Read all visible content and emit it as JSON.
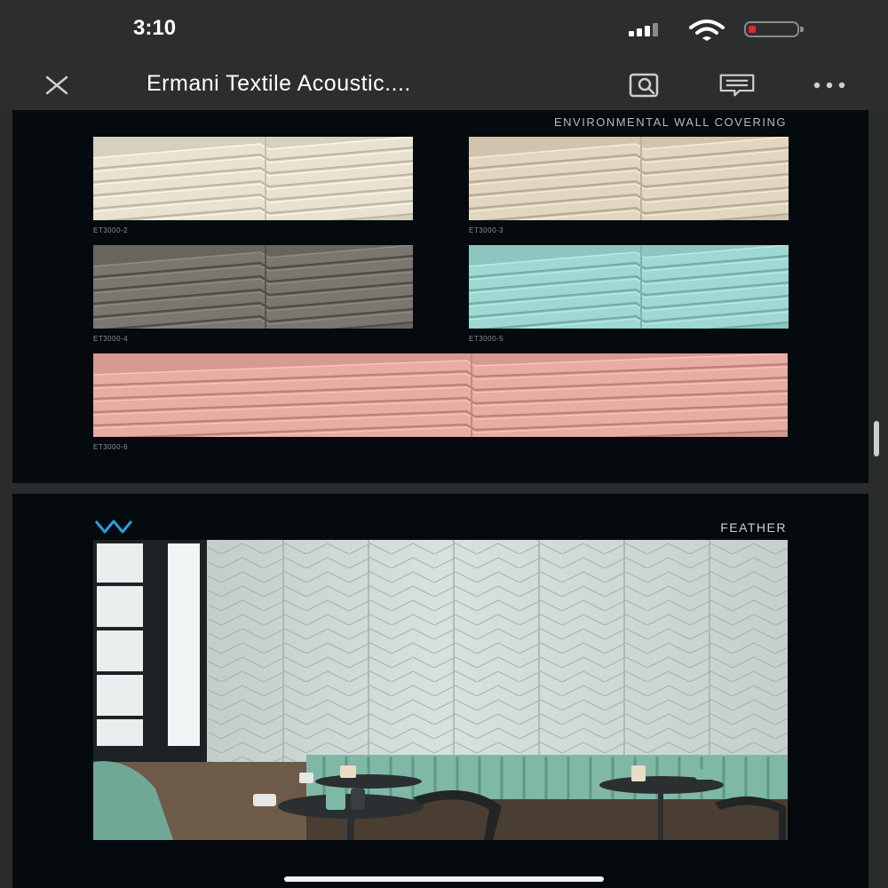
{
  "status_bar": {
    "time": "3:10"
  },
  "nav": {
    "title": "Ermani Textile Acoustic...."
  },
  "page1": {
    "section_title": "ENVIRONMENTAL WALL COVERING",
    "swatches": [
      {
        "code": "ET3000-2",
        "color": "#e9e2cf"
      },
      {
        "code": "ET3000-3",
        "color": "#e2d6c1"
      },
      {
        "code": "ET3000-4",
        "color": "#7a7670"
      },
      {
        "code": "ET3000-5",
        "color": "#9fd8d2"
      },
      {
        "code": "ET3000-6",
        "color": "#e7aca4"
      }
    ]
  },
  "page2": {
    "title": "FEATHER",
    "accent_color": "#2a9fd6"
  },
  "icons": [
    "close-icon",
    "find-in-document-icon",
    "comment-icon",
    "more-options-icon"
  ]
}
